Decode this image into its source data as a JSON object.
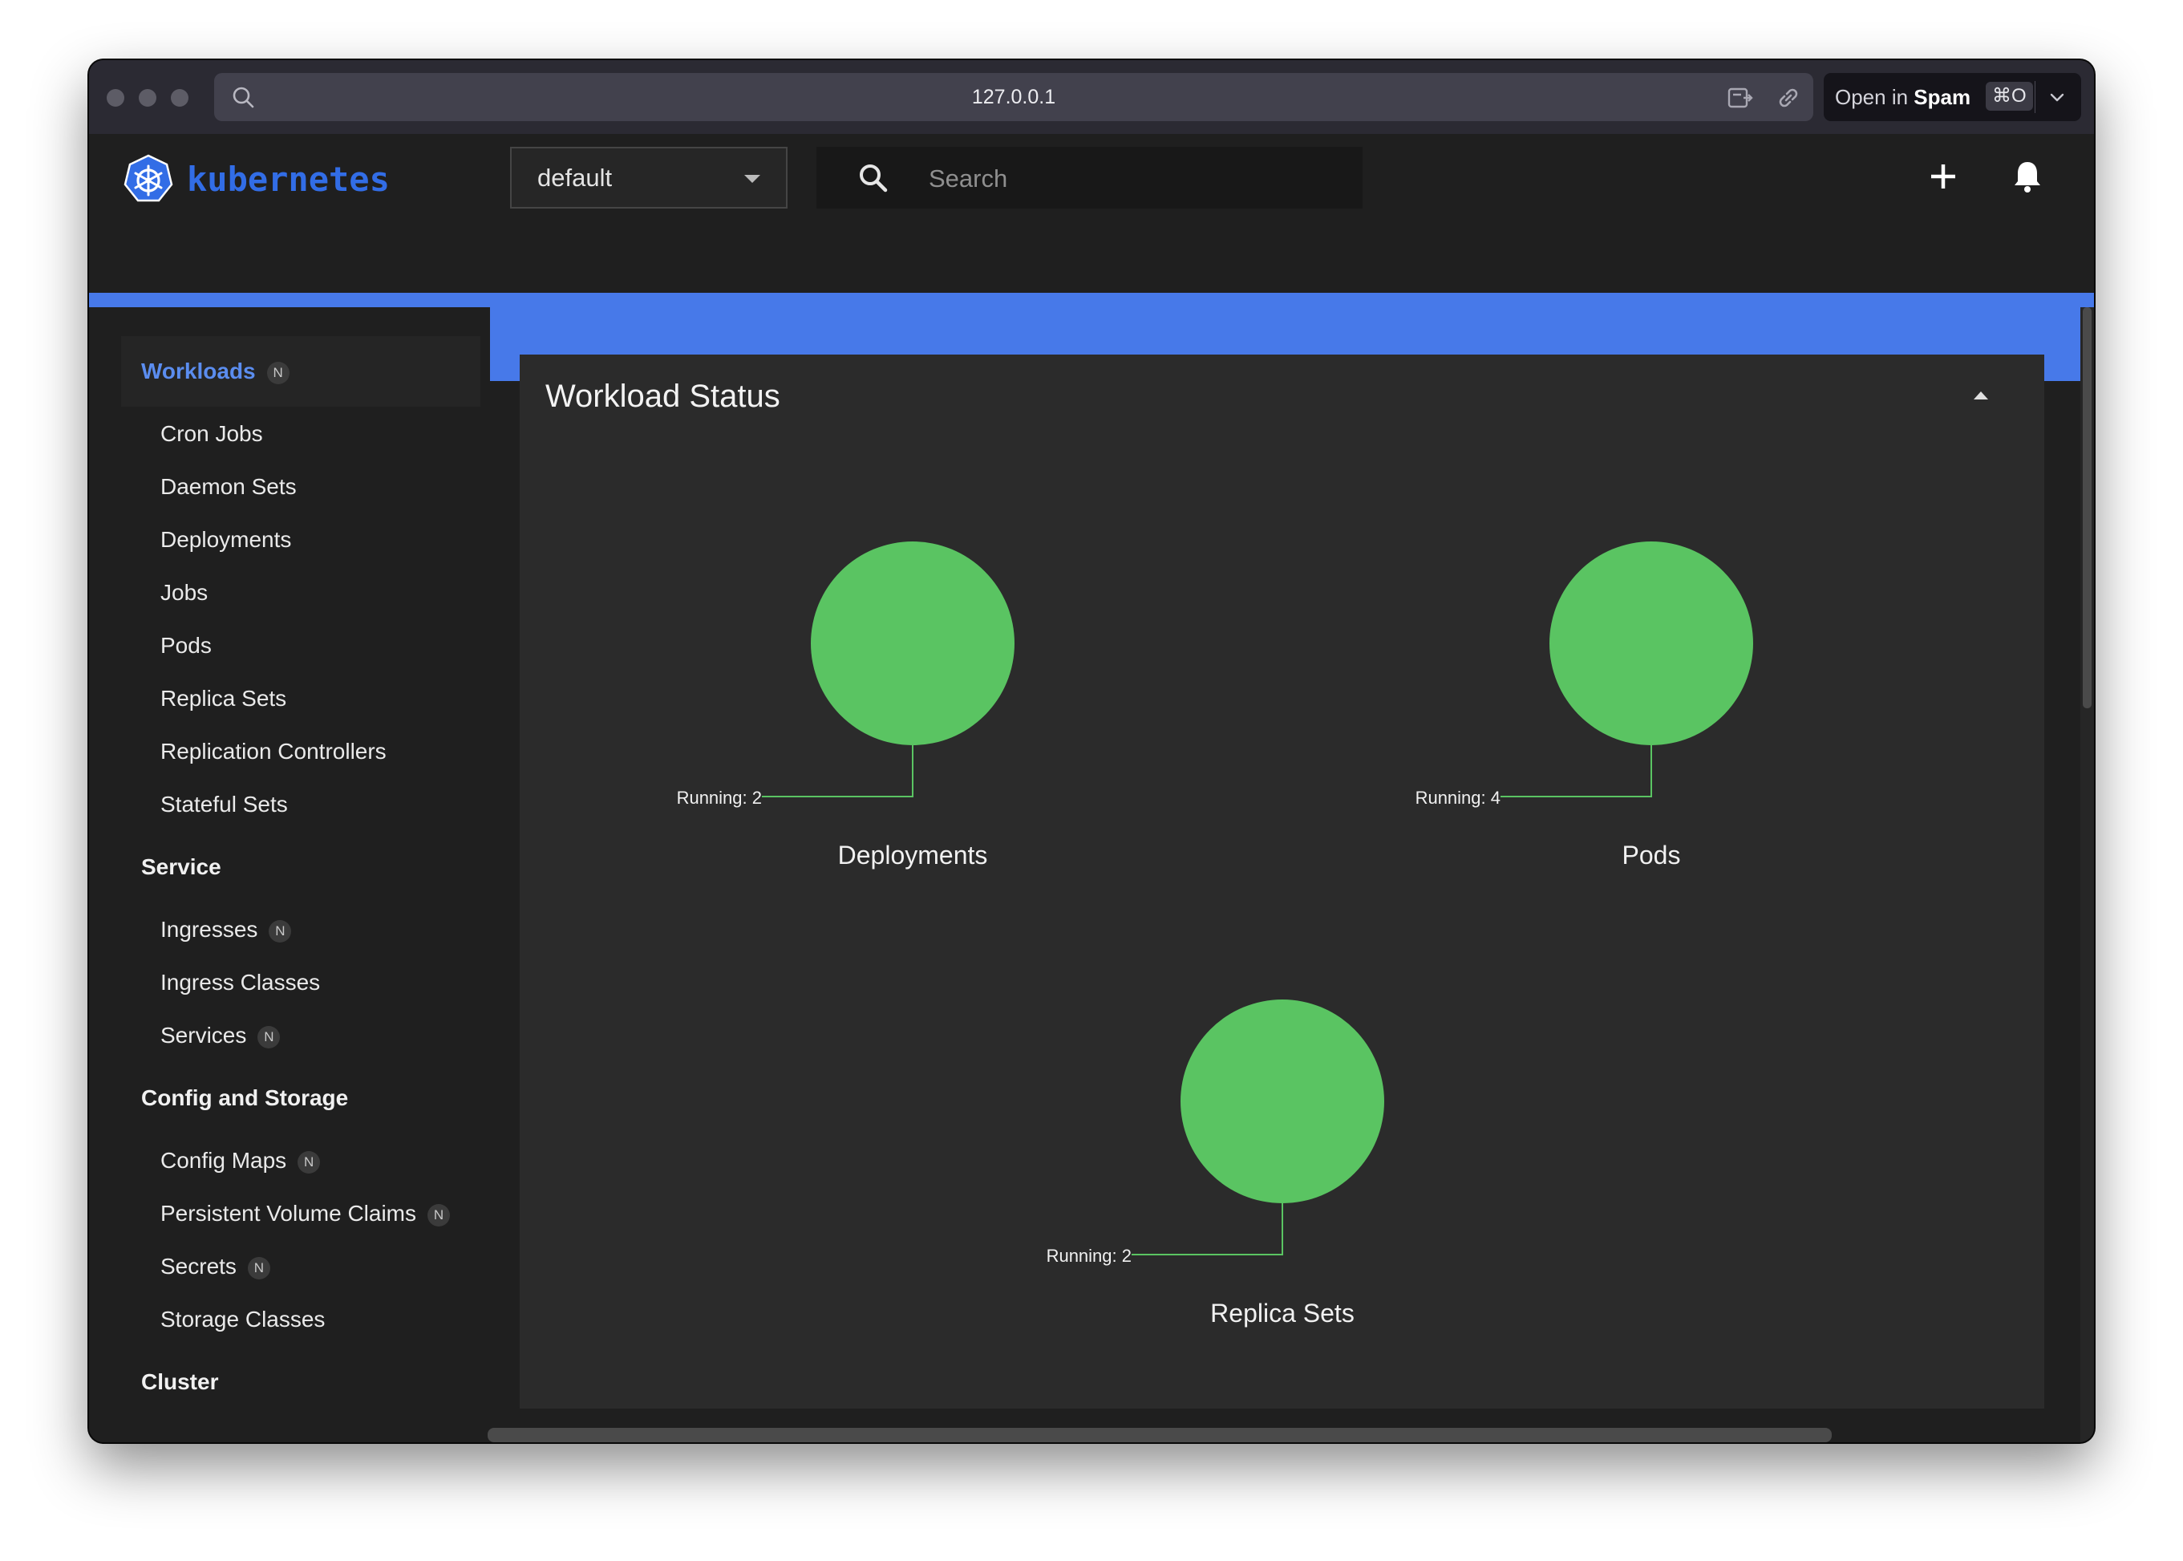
{
  "browser": {
    "url": "127.0.0.1",
    "open_in": {
      "prefix": "Open in ",
      "app": "Spam",
      "shortcut": "⌘O"
    }
  },
  "toolbar": {
    "brand": "kubernetes",
    "namespace": "default",
    "search_placeholder": "Search"
  },
  "page": {
    "title": "Workloads"
  },
  "sidebar": {
    "sections": [
      {
        "title": "Workloads",
        "badge": "N",
        "active": true,
        "items": [
          {
            "label": "Cron Jobs"
          },
          {
            "label": "Daemon Sets"
          },
          {
            "label": "Deployments"
          },
          {
            "label": "Jobs"
          },
          {
            "label": "Pods"
          },
          {
            "label": "Replica Sets"
          },
          {
            "label": "Replication Controllers"
          },
          {
            "label": "Stateful Sets"
          }
        ]
      },
      {
        "title": "Service",
        "items": [
          {
            "label": "Ingresses",
            "badge": "N"
          },
          {
            "label": "Ingress Classes"
          },
          {
            "label": "Services",
            "badge": "N"
          }
        ]
      },
      {
        "title": "Config and Storage",
        "items": [
          {
            "label": "Config Maps",
            "badge": "N"
          },
          {
            "label": "Persistent Volume Claims",
            "badge": "N"
          },
          {
            "label": "Secrets",
            "badge": "N"
          },
          {
            "label": "Storage Classes"
          }
        ]
      },
      {
        "title": "Cluster",
        "items": []
      }
    ]
  },
  "card": {
    "title": "Workload Status"
  },
  "colors": {
    "running": "#5ac462",
    "header_bar": "#4779e9",
    "brand": "#326de6"
  },
  "chart_data": [
    {
      "type": "pie",
      "title": "Deployments",
      "labels": [
        "Running"
      ],
      "values": [
        2
      ],
      "label_text": "Running: 2"
    },
    {
      "type": "pie",
      "title": "Pods",
      "labels": [
        "Running"
      ],
      "values": [
        4
      ],
      "label_text": "Running: 4"
    },
    {
      "type": "pie",
      "title": "Replica Sets",
      "labels": [
        "Running"
      ],
      "values": [
        2
      ],
      "label_text": "Running: 2"
    }
  ]
}
